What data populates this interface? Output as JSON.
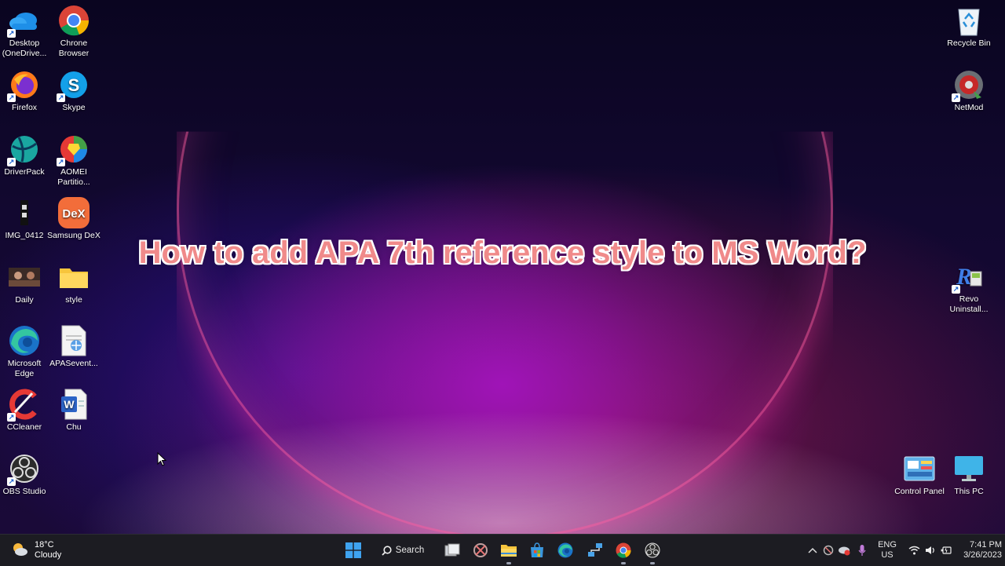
{
  "desktop": {
    "title_overlay": "How to add APA 7th reference style to MS Word?",
    "left_icons": [
      {
        "label": "Desktop (OneDrive..."
      },
      {
        "label": "Chrone Browser"
      },
      {
        "label": "Firefox"
      },
      {
        "label": "Skype"
      },
      {
        "label": "DriverPack"
      },
      {
        "label": "AOMEI Partitio..."
      },
      {
        "label": "IMG_0412"
      },
      {
        "label": "Samsung DeX"
      },
      {
        "label": "Daily"
      },
      {
        "label": "style"
      },
      {
        "label": "Microsoft Edge"
      },
      {
        "label": "APASevent..."
      },
      {
        "label": "CCleaner"
      },
      {
        "label": "Chu"
      },
      {
        "label": "OBS Studio"
      }
    ],
    "right_icons": [
      {
        "label": "Recycle Bin"
      },
      {
        "label": "NetMod"
      },
      {
        "label": "Revo Uninstall..."
      },
      {
        "label": "Control Panel"
      },
      {
        "label": "This PC"
      }
    ]
  },
  "taskbar": {
    "weather": {
      "temp": "18°C",
      "condition": "Cloudy"
    },
    "search_label": "Search",
    "language": {
      "line1": "ENG",
      "line2": "US"
    },
    "clock": {
      "time": "7:41 PM",
      "date": "3/26/2023"
    },
    "pinned": [
      "start-icon",
      "task-view-icon",
      "app-icon",
      "file-explorer-icon",
      "microsoft-store-icon",
      "edge-icon",
      "network-app-icon",
      "chrome-icon",
      "obs-icon"
    ]
  },
  "colors": {
    "title_fill": "#f08a8a",
    "title_stroke": "#ffffff",
    "taskbar_bg": "#1c1c22"
  }
}
